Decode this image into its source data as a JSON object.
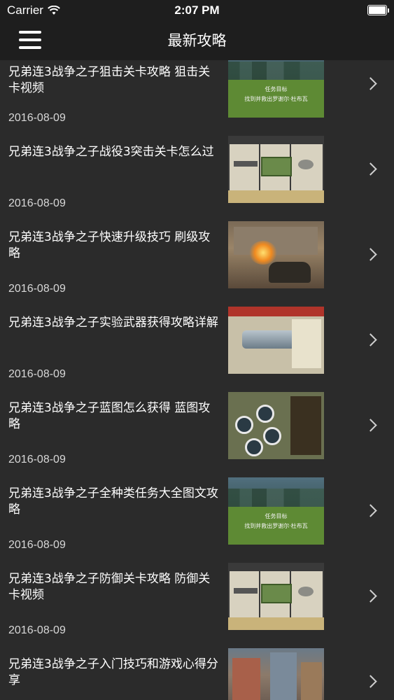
{
  "status_bar": {
    "carrier": "Carrier",
    "time": "2:07 PM",
    "wifi_icon": "wifi-icon",
    "battery_icon": "battery-icon"
  },
  "nav": {
    "title": "最新攻略",
    "menu_icon": "hamburger-menu-icon"
  },
  "articles": [
    {
      "title": "兄弟连3战争之子狙击关卡攻略 狙击关卡视频",
      "date": "2016-08-09",
      "thumb": "forest",
      "thumb_text1": "任务目标",
      "thumb_text2": "找到并救出罗谢尔·杜布瓦"
    },
    {
      "title": "兄弟连3战争之子战役3突击关卡怎么过",
      "date": "2016-08-09",
      "thumb": "crate"
    },
    {
      "title": "兄弟连3战争之子快速升级技巧 刷级攻略",
      "date": "2016-08-09",
      "thumb": "fire"
    },
    {
      "title": "兄弟连3战争之子实验武器获得攻略详解",
      "date": "2016-08-09",
      "thumb": "weapon"
    },
    {
      "title": "兄弟连3战争之子蓝图怎么获得 蓝图攻略",
      "date": "2016-08-09",
      "thumb": "map"
    },
    {
      "title": "兄弟连3战争之子全种类任务大全图文攻略",
      "date": "2016-08-09",
      "thumb": "forest",
      "thumb_text1": "任务目标",
      "thumb_text2": "找到并救出罗谢尔·杜布瓦"
    },
    {
      "title": "兄弟连3战争之子防御关卡攻略 防御关卡视频",
      "date": "2016-08-09",
      "thumb": "crate"
    },
    {
      "title": "兄弟连3战争之子入门技巧和游戏心得分享",
      "date": "",
      "thumb": "town"
    }
  ],
  "colors": {
    "background": "#2b2b2b",
    "bar": "#1e1e1e",
    "text": "#ffffff",
    "date_text": "#d8d8d8"
  }
}
